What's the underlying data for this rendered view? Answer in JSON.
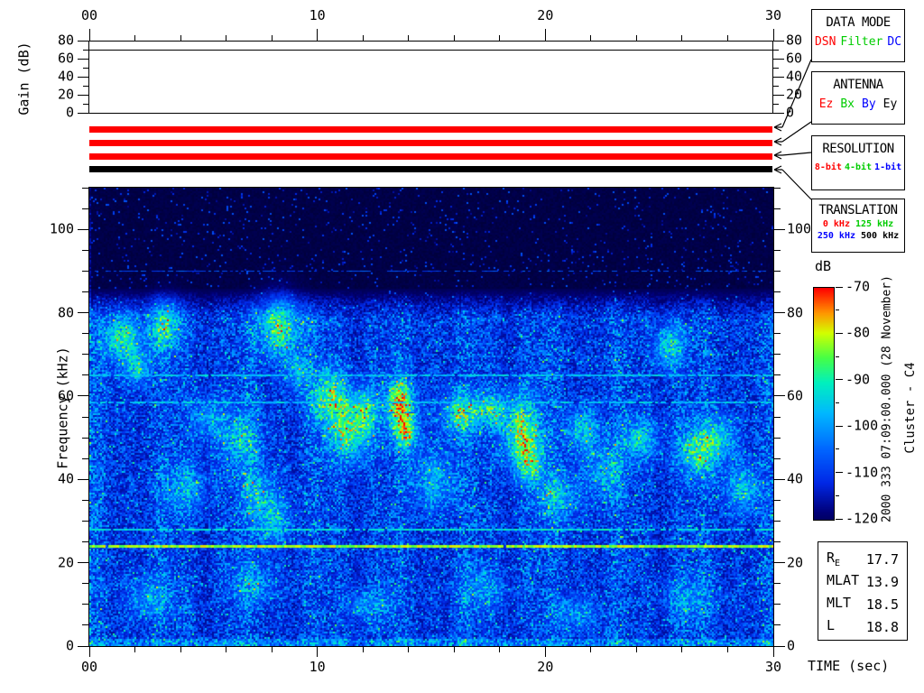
{
  "gain_panel": {
    "ylabel": "Gain (dB)",
    "ylim": [
      0,
      80
    ],
    "yticks": [
      0,
      20,
      40,
      60,
      80
    ],
    "trace_dB": 70
  },
  "time_axis": {
    "label": "TIME (sec)",
    "lim": [
      0,
      30
    ],
    "labels": [
      "00",
      "10",
      "20",
      "30"
    ],
    "minor_step": 2
  },
  "freq_axis": {
    "label": "Frequency (kHz)",
    "lim": [
      0,
      110
    ],
    "major": [
      0,
      20,
      40,
      60,
      80,
      100
    ],
    "minor_step": 5
  },
  "status_bars": [
    {
      "name": "data-mode",
      "selected": "DSN",
      "color": "#ff0000"
    },
    {
      "name": "antenna",
      "selected": "Ez",
      "color": "#ff0000"
    },
    {
      "name": "resolution",
      "selected": "8-bit",
      "color": "#ff0000"
    },
    {
      "name": "translation",
      "selected": "500 kHz",
      "color": "#000000"
    }
  ],
  "legend_boxes": {
    "data_mode": {
      "title": "DATA MODE",
      "options": [
        {
          "label": "DSN",
          "color": "#ff0000"
        },
        {
          "label": "Filter",
          "color": "#00cc00"
        },
        {
          "label": "DC",
          "color": "#0000ff"
        }
      ]
    },
    "antenna": {
      "title": "ANTENNA",
      "options": [
        {
          "label": "Ez",
          "color": "#ff0000"
        },
        {
          "label": "Bx",
          "color": "#00cc00"
        },
        {
          "label": "By",
          "color": "#0000ff"
        },
        {
          "label": "Ey",
          "color": "#000000"
        }
      ]
    },
    "resolution": {
      "title": "RESOLUTION",
      "options": [
        {
          "label": "8-bit",
          "color": "#ff0000"
        },
        {
          "label": "4-bit",
          "color": "#00cc00"
        },
        {
          "label": "1-bit",
          "color": "#0000ff"
        }
      ]
    },
    "translation": {
      "title": "TRANSLATION",
      "options": [
        {
          "label": "0 kHz",
          "color": "#ff0000"
        },
        {
          "label": "125 kHz",
          "color": "#00cc00"
        },
        {
          "label": "250 kHz",
          "color": "#0000ff"
        },
        {
          "label": "500 kHz",
          "color": "#000000"
        }
      ]
    }
  },
  "colorbar": {
    "label": "dB",
    "max_dB": -70,
    "min_dB": -120,
    "ticks": [
      "-70",
      "-80",
      "-90",
      "-100",
      "-110",
      "-120"
    ]
  },
  "side_text": {
    "datetime": "2000 333 07:09:00.000 (28 November)",
    "spacecraft": "Cluster - C4"
  },
  "ephemeris": {
    "rows": [
      {
        "label": "R",
        "sub": "E",
        "value": "17.7"
      },
      {
        "label": "MLAT",
        "sub": "",
        "value": "13.9"
      },
      {
        "label": "MLT",
        "sub": "",
        "value": "18.5"
      },
      {
        "label": "L",
        "sub": "",
        "value": "18.8"
      }
    ]
  },
  "chart_data": {
    "type": "heatmap",
    "x": {
      "label": "TIME (sec)",
      "units": "sec",
      "range": [
        0,
        30
      ],
      "ticks": [
        0,
        10,
        20,
        30
      ],
      "start_time": "2000 333 07:09:00.000 (28 November)"
    },
    "y": {
      "label": "Frequency (kHz)",
      "units": "kHz",
      "range": [
        0,
        110
      ],
      "ticks": [
        0,
        20,
        40,
        60,
        80,
        100
      ]
    },
    "z": {
      "label": "dB",
      "range": [
        -120,
        -70
      ],
      "colormap": "jet",
      "legend_position": "right"
    },
    "gain_series": {
      "label": "Gain (dB)",
      "range": [
        0,
        80
      ],
      "value_dB": 70
    },
    "spacecraft": "Cluster - C4",
    "status": {
      "data_mode": "DSN",
      "antenna": "Ez",
      "resolution": "8-bit",
      "translation": "500 kHz"
    },
    "noise_upper_cutoff_kHz": 83,
    "persistent_lines": [
      {
        "f": 90,
        "v": 0.3,
        "gap": 0.4,
        "h": 1
      },
      {
        "f": 65,
        "v": 0.52,
        "gap": 0.1,
        "h": 2
      },
      {
        "f": 58.5,
        "v": 0.52,
        "gap": 0.15,
        "h": 2
      },
      {
        "f": 56,
        "v": 0.3,
        "gap": 0.55,
        "h": 1
      },
      {
        "f": 33,
        "v": 0.3,
        "gap": 0.55,
        "h": 1
      },
      {
        "f": 28,
        "v": 0.58,
        "gap": 0.12,
        "h": 2
      },
      {
        "f": 24,
        "v": 0.78,
        "gap": 0.02,
        "h": 3
      }
    ],
    "emission_patches": [
      {
        "t": 1.4,
        "f": 74,
        "dt": 0.8,
        "df": 6,
        "a": 0.4
      },
      {
        "t": 2.1,
        "f": 67,
        "dt": 0.5,
        "df": 4,
        "a": 0.3
      },
      {
        "t": 3.3,
        "f": 77,
        "dt": 0.7,
        "df": 6,
        "a": 0.38
      },
      {
        "t": 4.2,
        "f": 38,
        "dt": 0.9,
        "df": 6,
        "a": 0.22
      },
      {
        "t": 5.1,
        "f": 55,
        "dt": 0.7,
        "df": 5,
        "a": 0.22
      },
      {
        "t": 6.6,
        "f": 50,
        "dt": 0.9,
        "df": 7,
        "a": 0.26
      },
      {
        "t": 7.4,
        "f": 36,
        "dt": 0.8,
        "df": 6,
        "a": 0.26
      },
      {
        "t": 8.3,
        "f": 77,
        "dt": 0.9,
        "df": 7,
        "a": 0.46
      },
      {
        "t": 8.1,
        "f": 30,
        "dt": 0.7,
        "df": 5,
        "a": 0.26
      },
      {
        "t": 9.1,
        "f": 66,
        "dt": 0.5,
        "df": 4,
        "a": 0.28
      },
      {
        "t": 10.5,
        "f": 60,
        "dt": 0.8,
        "df": 6,
        "a": 0.42
      },
      {
        "t": 11.4,
        "f": 52,
        "dt": 0.9,
        "df": 7,
        "a": 0.46
      },
      {
        "t": 12.1,
        "f": 57,
        "dt": 0.5,
        "df": 5,
        "a": 0.32
      },
      {
        "t": 13.6,
        "f": 58,
        "dt": 0.6,
        "df": 6,
        "a": 0.6
      },
      {
        "t": 13.9,
        "f": 51,
        "dt": 0.5,
        "df": 4,
        "a": 0.38
      },
      {
        "t": 15.1,
        "f": 40,
        "dt": 0.9,
        "df": 7,
        "a": 0.26
      },
      {
        "t": 16.3,
        "f": 56,
        "dt": 0.8,
        "df": 5,
        "a": 0.42
      },
      {
        "t": 17.6,
        "f": 57,
        "dt": 0.6,
        "df": 4,
        "a": 0.32
      },
      {
        "t": 18.9,
        "f": 52,
        "dt": 0.8,
        "df": 8,
        "a": 0.5
      },
      {
        "t": 19.3,
        "f": 44,
        "dt": 0.6,
        "df": 5,
        "a": 0.36
      },
      {
        "t": 20.6,
        "f": 36,
        "dt": 0.9,
        "df": 6,
        "a": 0.26
      },
      {
        "t": 21.6,
        "f": 52,
        "dt": 0.7,
        "df": 5,
        "a": 0.32
      },
      {
        "t": 22.6,
        "f": 42,
        "dt": 0.8,
        "df": 6,
        "a": 0.26
      },
      {
        "t": 24.1,
        "f": 50,
        "dt": 0.8,
        "df": 5,
        "a": 0.28
      },
      {
        "t": 25.4,
        "f": 72,
        "dt": 0.6,
        "df": 5,
        "a": 0.36
      },
      {
        "t": 26.6,
        "f": 47,
        "dt": 0.8,
        "df": 6,
        "a": 0.36
      },
      {
        "t": 27.6,
        "f": 50,
        "dt": 0.7,
        "df": 5,
        "a": 0.32
      },
      {
        "t": 28.6,
        "f": 38,
        "dt": 0.8,
        "df": 6,
        "a": 0.26
      },
      {
        "t": 2.6,
        "f": 12,
        "dt": 1.0,
        "df": 5,
        "a": 0.2
      },
      {
        "t": 7.1,
        "f": 15,
        "dt": 1.0,
        "df": 5,
        "a": 0.18
      },
      {
        "t": 12.2,
        "f": 10,
        "dt": 1.0,
        "df": 4,
        "a": 0.18
      },
      {
        "t": 17.2,
        "f": 14,
        "dt": 1.0,
        "df": 5,
        "a": 0.18
      },
      {
        "t": 21.2,
        "f": 8,
        "dt": 1.0,
        "df": 4,
        "a": 0.18
      },
      {
        "t": 26.2,
        "f": 12,
        "dt": 1.0,
        "df": 5,
        "a": 0.18
      }
    ]
  }
}
